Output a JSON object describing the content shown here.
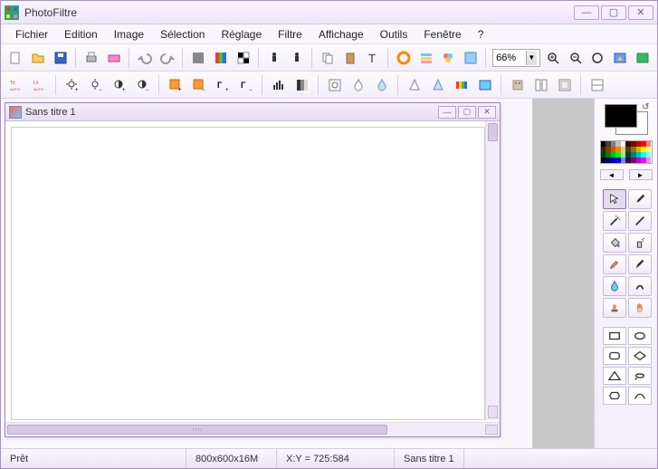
{
  "app": {
    "title": "PhotoFiltre"
  },
  "window_buttons": {
    "min": "—",
    "max": "▢",
    "close": "✕"
  },
  "menu": [
    "Fichier",
    "Edition",
    "Image",
    "Sélection",
    "Réglage",
    "Filtre",
    "Affichage",
    "Outils",
    "Fenêtre",
    "?"
  ],
  "zoom": {
    "value": "66%"
  },
  "document": {
    "title": "Sans titre 1",
    "win_min": "—",
    "win_max": "▢",
    "win_close": "✕"
  },
  "status": {
    "ready": "Prêt",
    "dims": "800x600x16M",
    "xy": "X:Y = 725:584",
    "doc": "Sans titre 1"
  },
  "colors": {
    "foreground": "#000000",
    "background": "#ffffff"
  },
  "palette_nav": {
    "prev": "◄",
    "next": "►"
  },
  "palette_rows": [
    [
      "#000",
      "#404040",
      "#808080",
      "#c0c0c0",
      "#fff",
      "#400000",
      "#800000",
      "#c00000",
      "#ff0000",
      "#ff8080"
    ],
    [
      "#402000",
      "#804000",
      "#c06000",
      "#ff8000",
      "#ffc080",
      "#404000",
      "#808000",
      "#c0c000",
      "#ffff00",
      "#ffff80"
    ],
    [
      "#004000",
      "#008000",
      "#00c000",
      "#00ff00",
      "#80ff80",
      "#004040",
      "#008080",
      "#00c0c0",
      "#00ffff",
      "#80ffff"
    ],
    [
      "#000040",
      "#000080",
      "#0000c0",
      "#0000ff",
      "#8080ff",
      "#400040",
      "#800080",
      "#c000c0",
      "#ff00ff",
      "#ff80ff"
    ]
  ]
}
